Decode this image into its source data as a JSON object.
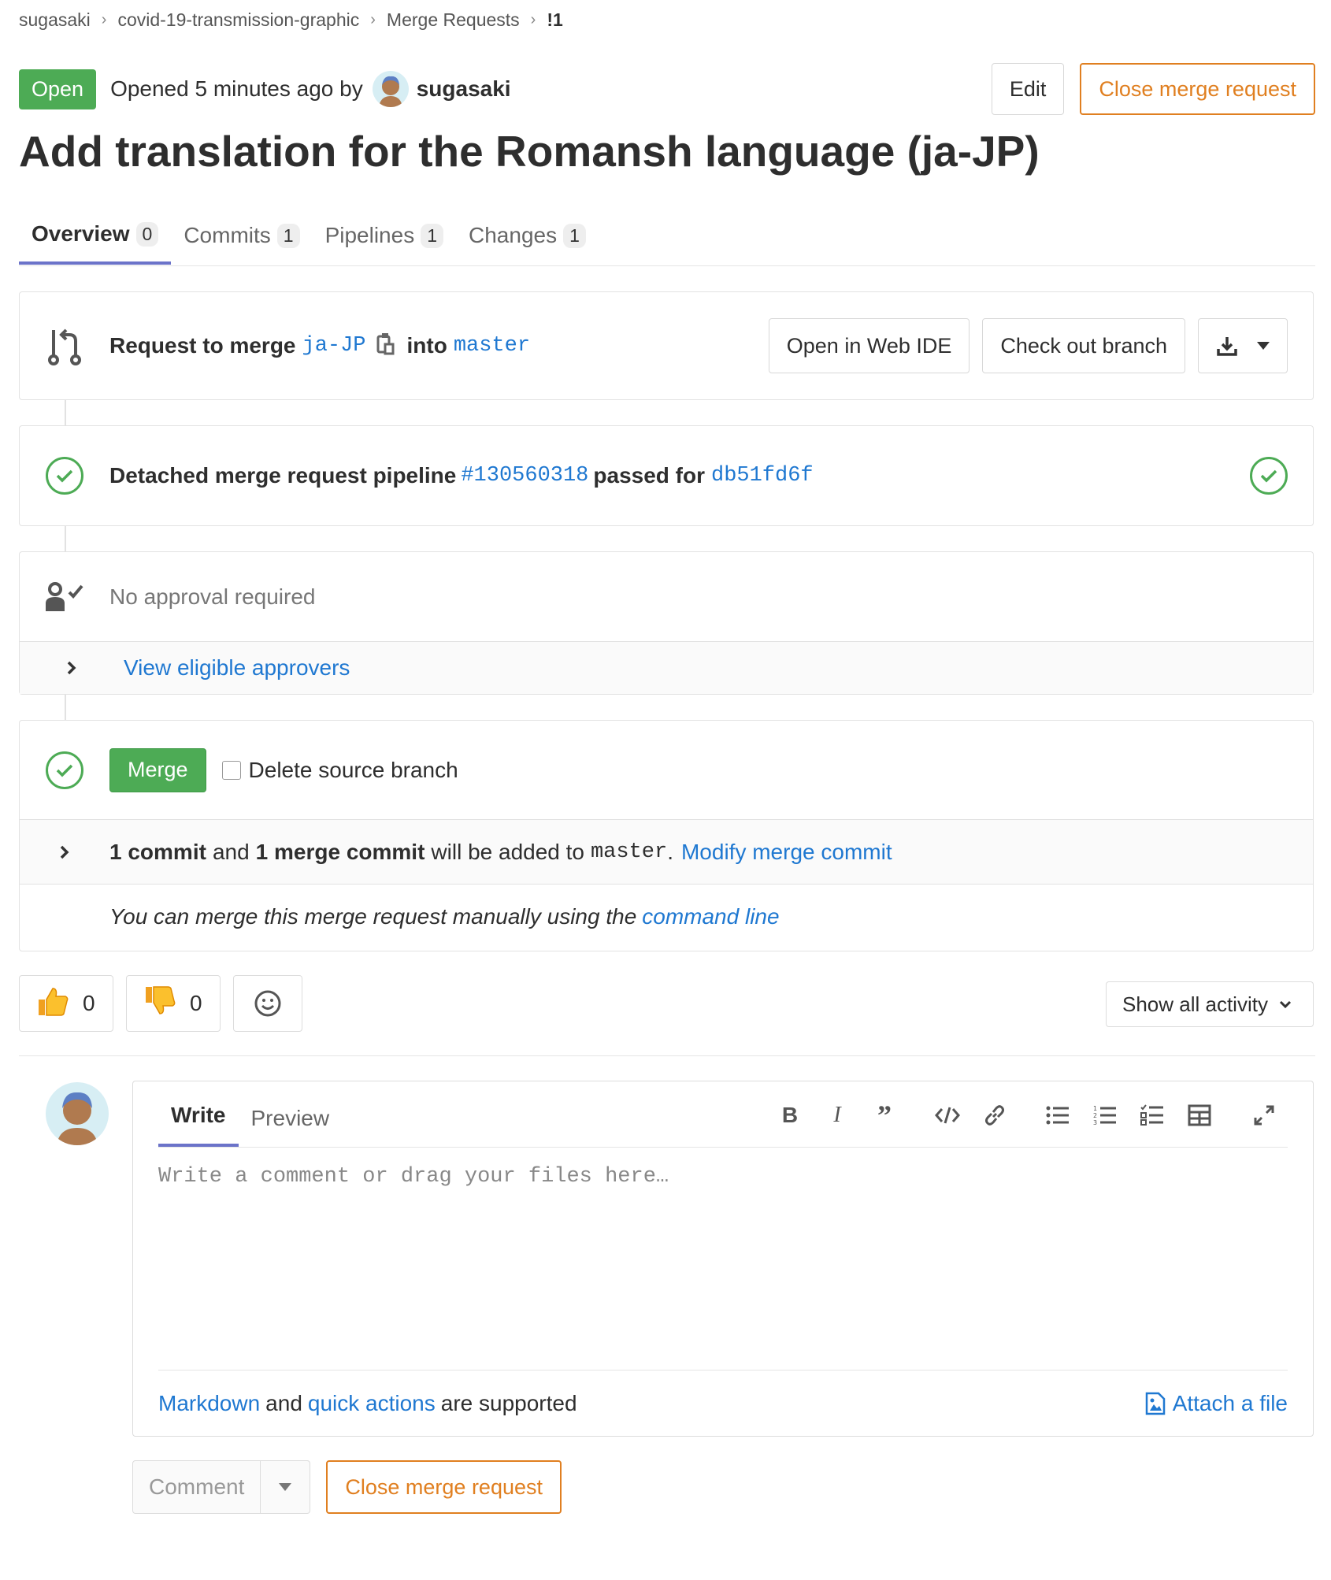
{
  "breadcrumb": {
    "items": [
      "sugasaki",
      "covid-19-transmission-graphic",
      "Merge Requests"
    ],
    "current": "!1"
  },
  "header": {
    "status": "Open",
    "opened_text": "Opened 5 minutes ago by",
    "author": "sugasaki",
    "edit_label": "Edit",
    "close_label": "Close merge request"
  },
  "title": "Add translation for the Romansh language (ja-JP)",
  "tabs": [
    {
      "label": "Overview",
      "count": "0"
    },
    {
      "label": "Commits",
      "count": "1"
    },
    {
      "label": "Pipelines",
      "count": "1"
    },
    {
      "label": "Changes",
      "count": "1"
    }
  ],
  "merge_info": {
    "request_to_merge": "Request to merge",
    "source_branch": "ja-JP",
    "into": "into",
    "target_branch": "master",
    "web_ide_label": "Open in Web IDE",
    "checkout_label": "Check out branch"
  },
  "pipeline": {
    "prefix": "Detached merge request pipeline",
    "id": "#130560318",
    "middle": "passed for",
    "commit": "db51fd6f"
  },
  "approval": {
    "text": "No approval required",
    "view_approvers": "View eligible approvers"
  },
  "merge": {
    "merge_label": "Merge",
    "delete_branch_label": "Delete source branch",
    "commit_count": "1 commit",
    "and": "and",
    "merge_commit": "1 merge commit",
    "will_be_added": "will be added to",
    "target": "master",
    "period": ".",
    "modify_label": "Modify merge commit",
    "manual_text": "You can merge this merge request manually using the",
    "command_line": "command line"
  },
  "reactions": {
    "thumbs_up": "0",
    "thumbs_down": "0",
    "activity_label": "Show all activity"
  },
  "editor": {
    "write_tab": "Write",
    "preview_tab": "Preview",
    "placeholder": "Write a comment or drag your files here…",
    "markdown": "Markdown",
    "and": "and",
    "quick_actions": "quick actions",
    "supported": "are supported",
    "attach": "Attach a file"
  },
  "footer": {
    "comment_label": "Comment",
    "close_label": "Close merge request"
  },
  "colors": {
    "accent_green": "#4dab55",
    "link_blue": "#1f78d1",
    "warning_orange": "#e07f20",
    "tab_underline": "#6b73c9"
  }
}
